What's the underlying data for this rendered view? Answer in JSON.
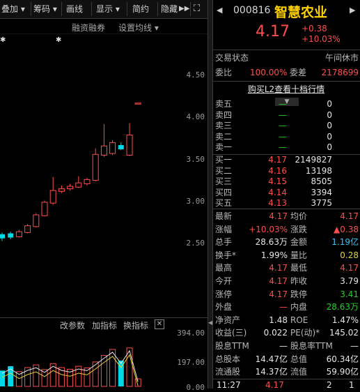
{
  "toolbar": {
    "items": [
      "叠加",
      "筹码",
      "画线",
      "显示",
      "简约",
      "隐藏"
    ],
    "overlay_label": "叠加",
    "chips_label": "筹码",
    "draw_label": "画线",
    "display_label": "显示",
    "simple_label": "简约",
    "hide_label": "隐藏"
  },
  "subbar": {
    "margin_label": "融资融券",
    "ma_label": "设置均线"
  },
  "price_axis": [
    "4.50",
    "4.00",
    "3.50",
    "3.00",
    "2.50"
  ],
  "volume_axis": [
    "394.00",
    "197.00",
    "0.00"
  ],
  "indicator_bar": {
    "change_params": "改参数",
    "add_indicator": "加指标",
    "switch_indicator": "换指标"
  },
  "stock": {
    "code": "000816",
    "name": "智慧农业",
    "price": "4.17",
    "change": "+0.38",
    "change_pct": "+10.03%"
  },
  "status": {
    "label": "交易状态",
    "value": "午间休市"
  },
  "ratio": {
    "wb_label": "委比",
    "wb_value": "100.00%",
    "wc_label": "委差",
    "wc_value": "2178699"
  },
  "l2_link": "购买L2查看十档行情",
  "sell_orders": [
    {
      "label": "卖五",
      "price": "—",
      "vol": "0"
    },
    {
      "label": "卖四",
      "price": "—",
      "vol": "0"
    },
    {
      "label": "卖三",
      "price": "—",
      "vol": "0"
    },
    {
      "label": "卖二",
      "price": "—",
      "vol": "0"
    },
    {
      "label": "卖一",
      "price": "—",
      "vol": "0"
    }
  ],
  "buy_orders": [
    {
      "label": "买一",
      "price": "4.17",
      "vol": "2149827"
    },
    {
      "label": "买二",
      "price": "4.16",
      "vol": "13198"
    },
    {
      "label": "买三",
      "price": "4.15",
      "vol": "8505"
    },
    {
      "label": "买四",
      "price": "4.14",
      "vol": "3394"
    },
    {
      "label": "买五",
      "price": "4.13",
      "vol": "3775"
    }
  ],
  "stats": [
    {
      "l1": "最新",
      "v1": "4.17",
      "c1": "red",
      "l2": "均价",
      "v2": "4.17",
      "c2": "red"
    },
    {
      "l1": "涨幅",
      "v1": "+10.03%",
      "c1": "red",
      "l2": "涨跌",
      "v2": "▲0.38",
      "c2": "red"
    },
    {
      "l1": "总手",
      "v1": "28.63万",
      "c1": "white",
      "l2": "金额",
      "v2": "1.19亿",
      "c2": "cyan"
    },
    {
      "l1": "换手*",
      "v1": "1.99%",
      "c1": "white",
      "l2": "量比",
      "v2": "0.28",
      "c2": "yellow"
    },
    {
      "l1": "最高",
      "v1": "4.17",
      "c1": "red",
      "l2": "最低",
      "v2": "4.17",
      "c2": "red"
    },
    {
      "l1": "今开",
      "v1": "4.17",
      "c1": "red",
      "l2": "昨收",
      "v2": "3.79",
      "c2": "white"
    },
    {
      "l1": "涨停",
      "v1": "4.17",
      "c1": "red",
      "l2": "跌停",
      "v2": "3.41",
      "c2": "green"
    },
    {
      "l1": "外盘",
      "v1": "—",
      "c1": "red",
      "l2": "内盘",
      "v2": "28.63万",
      "c2": "green"
    },
    {
      "l1": "净资产",
      "v1": "1.48",
      "c1": "white",
      "l2": "ROE",
      "v2": "1.47%",
      "c2": "white"
    },
    {
      "l1": "收益(三)",
      "v1": "0.022",
      "c1": "white",
      "l2": "PE(动)*",
      "v2": "145.02",
      "c2": "white"
    },
    {
      "l1": "股息TTM",
      "v1": "—",
      "c1": "white",
      "l2": "股息率TTM",
      "v2": "—",
      "c2": "white"
    },
    {
      "l1": "总股本",
      "v1": "14.47亿",
      "c1": "white",
      "l2": "总值",
      "v2": "60.34亿",
      "c2": "white"
    },
    {
      "l1": "流通股",
      "v1": "14.37亿",
      "c1": "white",
      "l2": "流值",
      "v2": "59.90亿",
      "c2": "white"
    }
  ],
  "tick": {
    "time": "11:27",
    "price": "4.17",
    "vol": "2",
    "count": "1"
  },
  "colors": {
    "up": "#ff4d4d",
    "down": "#00d8e8",
    "background": "#000000"
  },
  "chart_data": {
    "type": "candlestick",
    "ylim": [
      2.25,
      4.75
    ],
    "candles": [
      {
        "o": 2.56,
        "c": 2.61,
        "h": 2.63,
        "l": 2.53,
        "dir": "down"
      },
      {
        "o": 2.57,
        "c": 2.62,
        "h": 2.64,
        "l": 2.55,
        "dir": "down"
      },
      {
        "o": 2.58,
        "c": 2.64,
        "h": 2.66,
        "l": 2.57,
        "dir": "up"
      },
      {
        "o": 2.63,
        "c": 2.71,
        "h": 2.73,
        "l": 2.62,
        "dir": "up"
      },
      {
        "o": 2.7,
        "c": 2.84,
        "h": 2.86,
        "l": 2.69,
        "dir": "up"
      },
      {
        "o": 2.83,
        "c": 2.99,
        "h": 3.01,
        "l": 2.82,
        "dir": "up"
      },
      {
        "o": 2.98,
        "c": 3.13,
        "h": 3.29,
        "l": 2.96,
        "dir": "up"
      },
      {
        "o": 3.12,
        "c": 3.15,
        "h": 3.19,
        "l": 3.1,
        "dir": "up"
      },
      {
        "o": 3.15,
        "c": 3.18,
        "h": 3.21,
        "l": 3.13,
        "dir": "up"
      },
      {
        "o": 3.17,
        "c": 3.22,
        "h": 3.3,
        "l": 3.16,
        "dir": "up"
      },
      {
        "o": 3.21,
        "c": 3.26,
        "h": 3.28,
        "l": 3.19,
        "dir": "up"
      },
      {
        "o": 3.25,
        "c": 3.56,
        "h": 3.63,
        "l": 3.24,
        "dir": "up"
      },
      {
        "o": 3.55,
        "c": 3.66,
        "h": 3.92,
        "l": 3.53,
        "dir": "up"
      },
      {
        "o": 3.57,
        "c": 3.7,
        "h": 3.73,
        "l": 3.55,
        "dir": "up"
      },
      {
        "o": 3.67,
        "c": 3.62,
        "h": 3.7,
        "l": 3.61,
        "dir": "down"
      },
      {
        "o": 3.55,
        "c": 3.79,
        "h": 3.93,
        "l": 3.54,
        "dir": "up"
      },
      {
        "o": 4.17,
        "c": 4.17,
        "h": 4.17,
        "l": 4.17,
        "dir": "up"
      }
    ],
    "volume_ylim": [
      0,
      394
    ],
    "volumes": [
      118,
      150,
      110,
      140,
      160,
      125,
      170,
      140,
      128,
      150,
      138,
      182,
      230,
      275,
      192,
      286,
      56
    ],
    "volume_dirs": [
      "down",
      "down",
      "up",
      "up",
      "up",
      "up",
      "up",
      "up",
      "up",
      "up",
      "up",
      "up",
      "up",
      "up",
      "down",
      "up",
      "up"
    ]
  }
}
